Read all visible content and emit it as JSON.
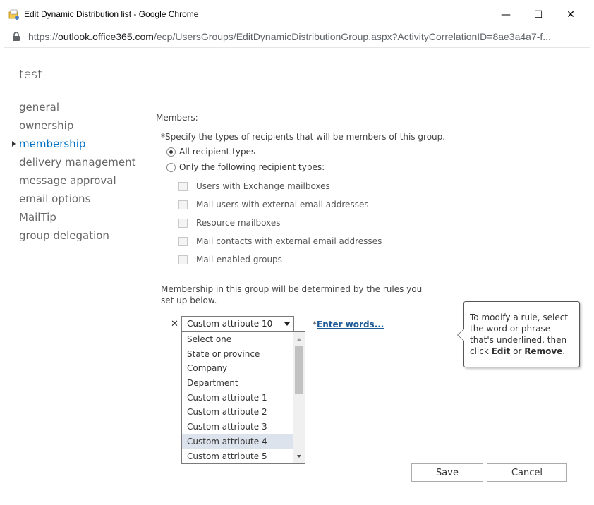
{
  "window": {
    "title": "Edit Dynamic Distribution list - Google Chrome",
    "minimize": "—",
    "maximize": "☐",
    "close": "✕"
  },
  "address": {
    "scheme": "https://",
    "host": "outlook.office365.com",
    "path": "/ecp/UsersGroups/EditDynamicDistributionGroup.aspx?ActivityCorrelationID=8ae3a4a7-f..."
  },
  "dialog": {
    "title": "test"
  },
  "nav": {
    "items": [
      {
        "label": "general"
      },
      {
        "label": "ownership"
      },
      {
        "label": "membership",
        "active": true
      },
      {
        "label": "delivery management"
      },
      {
        "label": "message approval"
      },
      {
        "label": "email options"
      },
      {
        "label": "MailTip"
      },
      {
        "label": "group delegation"
      }
    ]
  },
  "members": {
    "label": "Members:",
    "specify": "*Specify the types of recipients that will be members of this group.",
    "radio_all": "All recipient types",
    "radio_only": "Only the following recipient types:",
    "checkboxes": [
      "Users with Exchange mailboxes",
      "Mail users with external email addresses",
      "Resource mailboxes",
      "Mail contacts with external email addresses",
      "Mail-enabled groups"
    ]
  },
  "rules": {
    "note": "Membership in this group will be determined by the rules you set up below.",
    "remove": "✕",
    "selected": "Custom attribute 10",
    "enter_prefix": "*",
    "enter_words": "Enter words...",
    "options": [
      "Select one",
      "State or province",
      "Company",
      "Department",
      "Custom attribute 1",
      "Custom attribute 2",
      "Custom attribute 3",
      "Custom attribute 4",
      "Custom attribute 5"
    ],
    "hovered_index": 7
  },
  "tooltip": {
    "text1": "To modify a rule, select the word or phrase that's underlined, then click ",
    "edit": "Edit",
    "text2": " or ",
    "remove": "Remove",
    "text3": "."
  },
  "buttons": {
    "save": "Save",
    "cancel": "Cancel"
  },
  "colors": {
    "accent": "#0072c6",
    "link": "#1e5a96",
    "hover": "#dde3ec"
  }
}
